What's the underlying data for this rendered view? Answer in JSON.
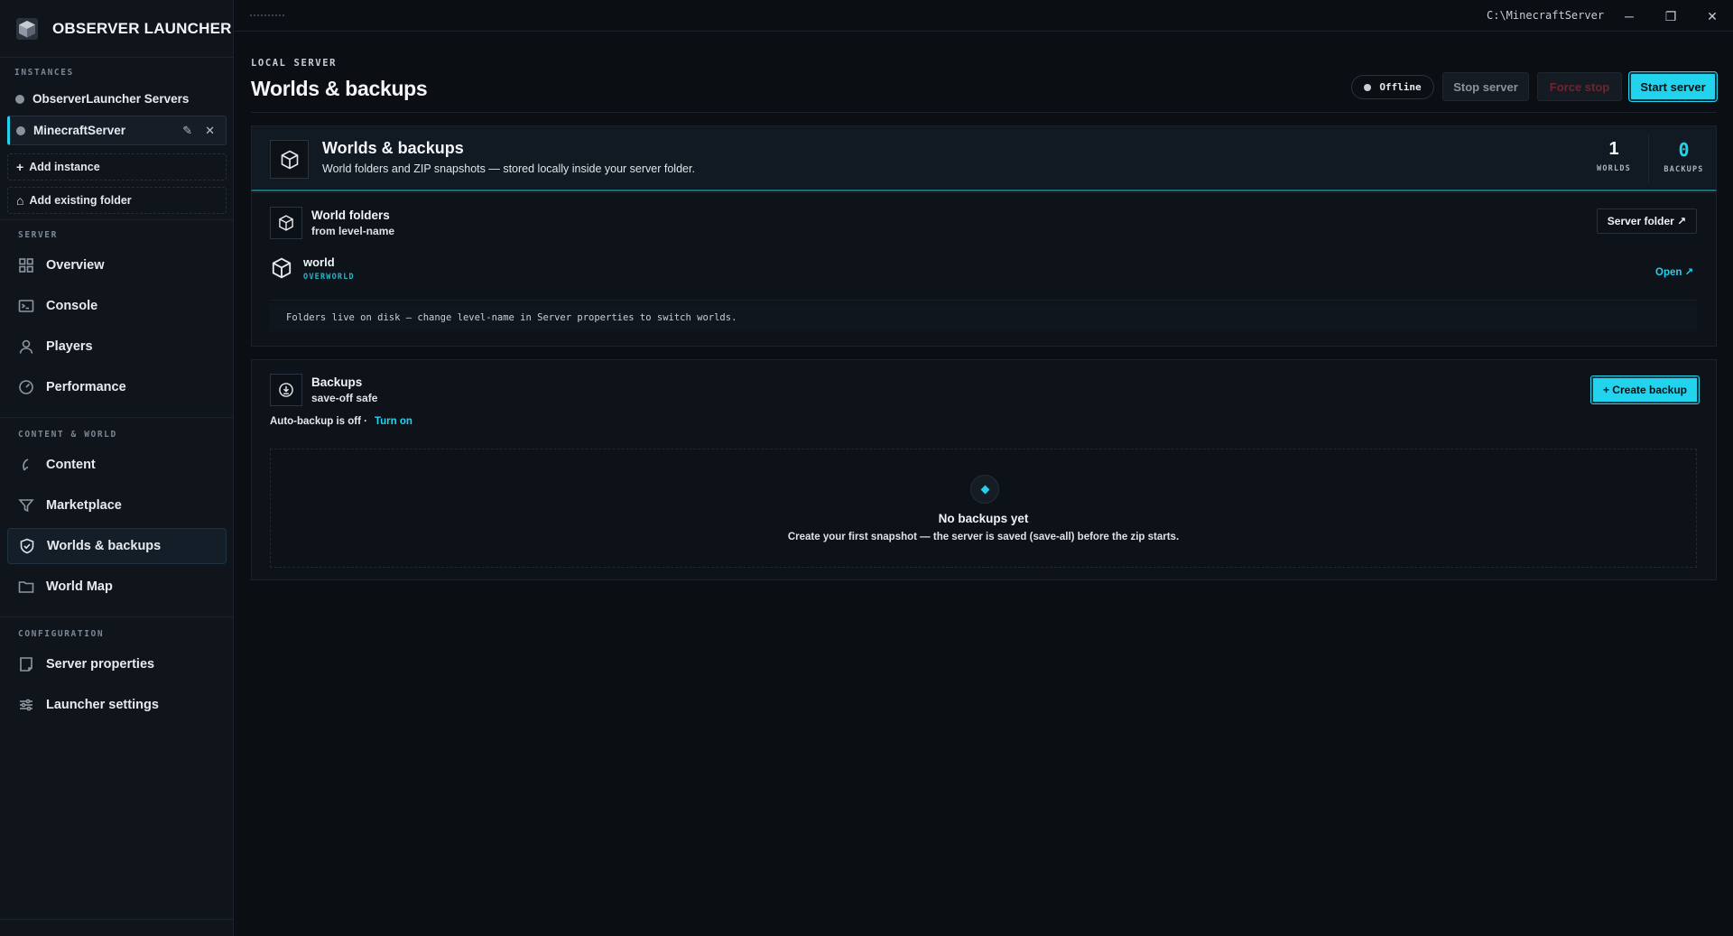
{
  "app": {
    "title": "OBSERVER LAUNCHER"
  },
  "window": {
    "path": "C:\\MinecraftServer",
    "minimize": "─",
    "maximize": "❐",
    "close": "✕"
  },
  "sidebar": {
    "instances_label": "INSTANCES",
    "instances": [
      {
        "name": "ObserverLauncher Servers"
      },
      {
        "name": "MinecraftServer",
        "edit": "✎",
        "close": "✕"
      }
    ],
    "add_instance": "Add instance",
    "add_existing_folder": "Add existing folder",
    "sections": {
      "server": "SERVER",
      "content_world": "CONTENT & WORLD",
      "configuration": "CONFIGURATION"
    },
    "nav": {
      "overview": "Overview",
      "console": "Console",
      "players": "Players",
      "performance": "Performance",
      "content": "Content",
      "marketplace": "Marketplace",
      "worlds_backups": "Worlds & backups",
      "world_map": "World Map",
      "server_properties": "Server properties",
      "launcher_settings": "Launcher settings"
    }
  },
  "header": {
    "eyebrow": "LOCAL SERVER",
    "title": "Worlds & backups",
    "status": "Offline",
    "stop": "Stop server",
    "force_stop": "Force stop",
    "start": "Start server"
  },
  "hero": {
    "title": "Worlds & backups",
    "subtitle": "World folders and ZIP snapshots — stored locally inside your server folder.",
    "worlds_count": "1",
    "worlds_label": "WORLDS",
    "backups_count": "0",
    "backups_label": "BACKUPS"
  },
  "world_folders": {
    "title": "World folders",
    "subtitle": "from level-name",
    "server_folder_btn": "Server folder ↗",
    "worlds": [
      {
        "name": "world",
        "dimension": "OVERWORLD",
        "open": "Open ↗"
      }
    ],
    "hint": "Folders live on disk — change level-name in Server properties to switch worlds."
  },
  "backups": {
    "title": "Backups",
    "subtitle": "save-off safe",
    "create_btn": "+ Create backup",
    "auto_status": "Auto-backup is off ·",
    "turn_on": "Turn on",
    "empty_title": "No backups yet",
    "empty_sub": "Create your first snapshot — the server is saved (save-all) before the zip starts."
  },
  "colors": {
    "accent": "#22d3ee",
    "background": "#0b0e13",
    "sidebar": "#10151c"
  }
}
